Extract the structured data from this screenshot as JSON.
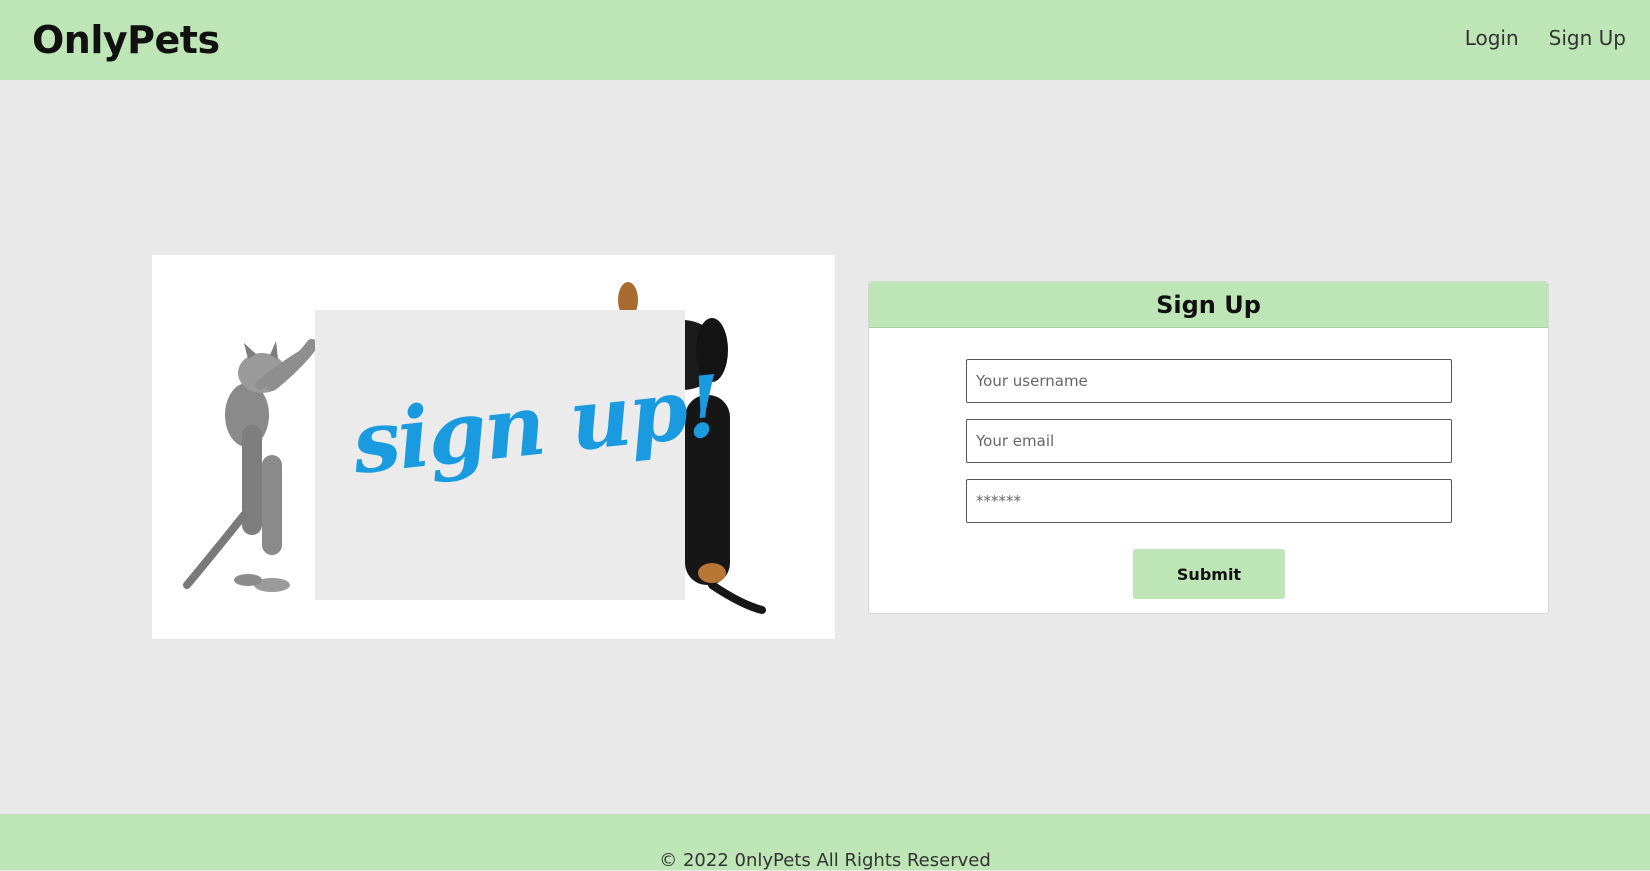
{
  "navbar": {
    "brand": "OnlyPets",
    "links": [
      "Login",
      "Sign Up"
    ]
  },
  "hero": {
    "sign_text": "sign up!",
    "image_subjects": [
      "kitten",
      "puppy"
    ]
  },
  "form": {
    "title": "Sign Up",
    "username_placeholder": "Your username",
    "email_placeholder": "Your email",
    "password_placeholder": "******",
    "submit_label": "Submit"
  },
  "footer": {
    "text": "© 2022 0nlyPets All Rights Reserved"
  },
  "colors": {
    "accent": "#bde5b6",
    "background": "#e9e9e9",
    "sign_text": "#1a9be0"
  }
}
